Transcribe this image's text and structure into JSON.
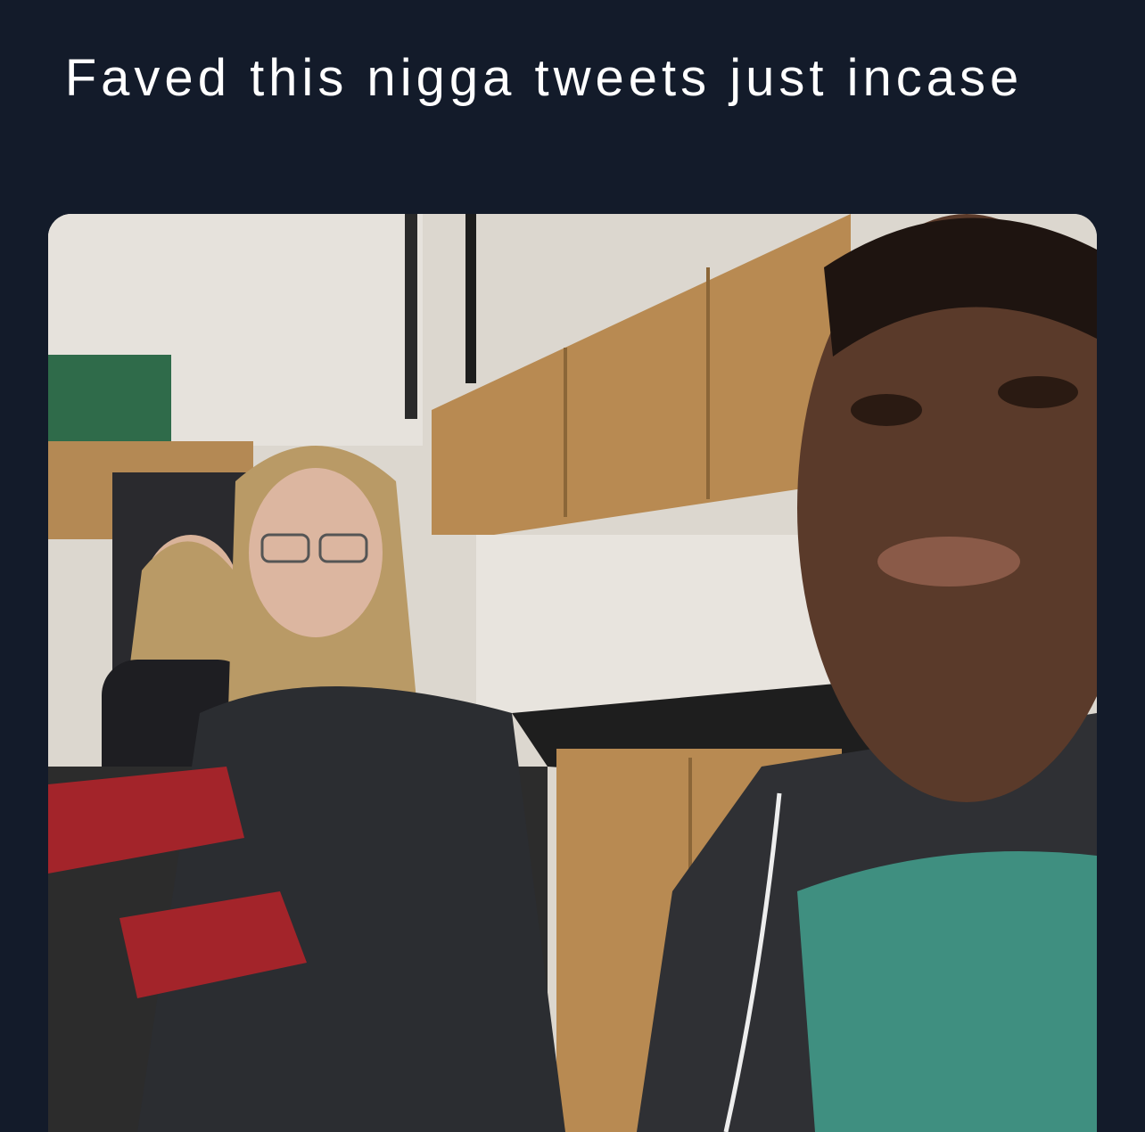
{
  "post": {
    "caption": "Faved this nigga tweets just incase"
  },
  "image": {
    "description_icon": "selfie-photo",
    "colors": {
      "background": "#131b2a",
      "caption_text": "#ffffff",
      "wall": "#d9d4cc",
      "cabinet": "#b48954",
      "countertop": "#1e1e1e",
      "jacket_dark": "#2b2d31",
      "jacket_red": "#a3242a",
      "shirt_teal": "#3f8f80",
      "skin_dark": "#5a3a2a",
      "skin_light": "#d9b39a",
      "hair_blonde": "#b99a66"
    }
  }
}
